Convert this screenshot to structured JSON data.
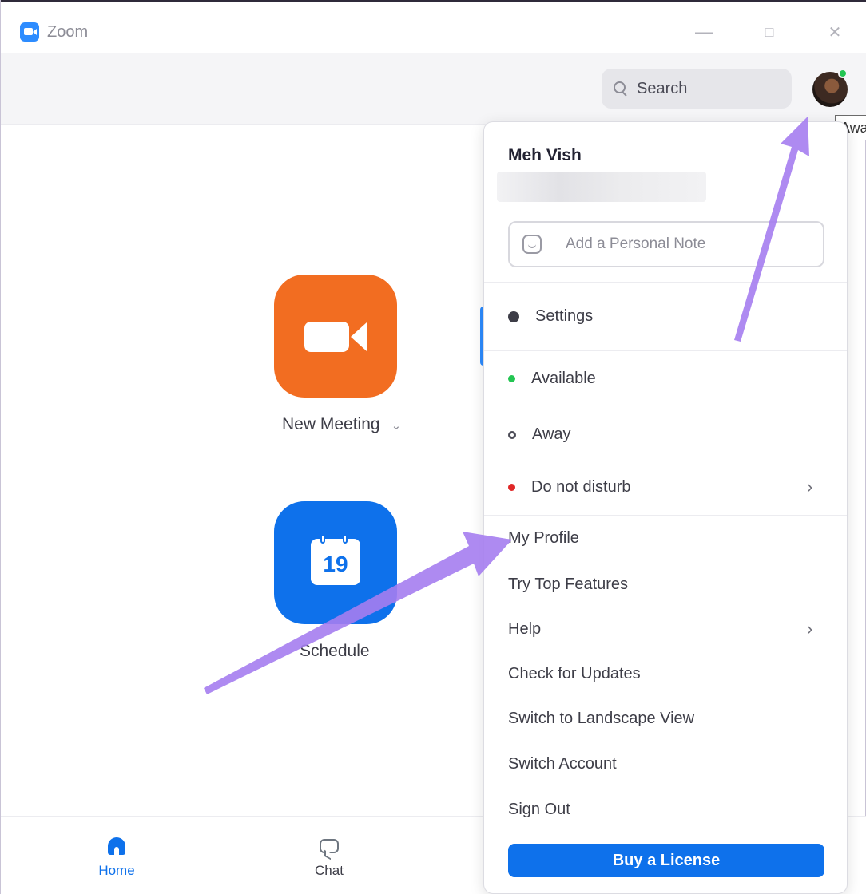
{
  "window": {
    "title": "Zoom",
    "controls": {
      "minimize": "—",
      "maximize": "□",
      "close": "✕"
    }
  },
  "header": {
    "search_label": "Search",
    "avatar_tooltip": "Away"
  },
  "home": {
    "new_meeting_label": "New Meeting",
    "schedule_label": "Schedule",
    "calendar_day": "19"
  },
  "bottom_nav": {
    "items": [
      {
        "label": "Home",
        "icon": "home-icon",
        "active": true
      },
      {
        "label": "Chat",
        "icon": "chat-icon",
        "active": false
      }
    ]
  },
  "profile_menu": {
    "user_name": "Meh Vish",
    "personal_note_placeholder": "Add a Personal Note",
    "settings_label": "Settings",
    "status_items": [
      {
        "label": "Available",
        "color": "#23c552"
      },
      {
        "label": "Away",
        "color": "#4a4a55"
      },
      {
        "label": "Do not disturb",
        "color": "#e02828"
      }
    ],
    "items": [
      "My Profile",
      "Try Top Features",
      "Help",
      "Check for Updates",
      "Switch to Landscape View",
      "Switch Account",
      "Sign Out"
    ],
    "buy_license_label": "Buy a License"
  },
  "colors": {
    "accent": "#0e71eb",
    "new_meeting": "#f26d21",
    "annotation_arrow": "#a57df0"
  }
}
